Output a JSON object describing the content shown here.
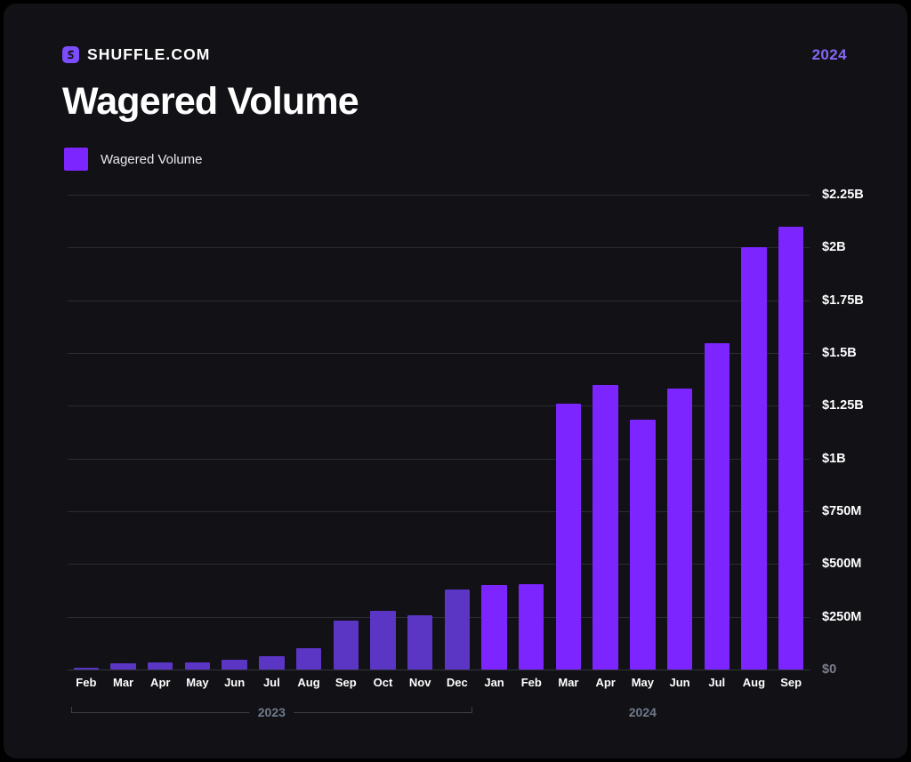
{
  "header": {
    "brand_name": "SHUFFLE.COM",
    "brand_icon": "shuffle-logo-icon",
    "year_badge": "2024",
    "title": "Wagered Volume"
  },
  "legend": {
    "swatch_color": "#7C25FF",
    "label": "Wagered Volume"
  },
  "colors": {
    "background": "#111116",
    "page_background": "#000000",
    "bar_2023": "#5B35C4",
    "bar_2024": "#7C25FF",
    "gridline": "#2B2B33",
    "text_primary": "#FFFFFF",
    "text_muted": "#707A8A",
    "accent": "#8567F2"
  },
  "chart_data": {
    "type": "bar",
    "title": "Wagered Volume",
    "xlabel": "",
    "ylabel": "",
    "ylim": [
      0,
      2250000000
    ],
    "grid": true,
    "legend_position": "top-left",
    "ytick_labels": [
      "$2.25B",
      "$2B",
      "$1.75B",
      "$1.5B",
      "$1.25B",
      "$1B",
      "$750M",
      "$500M",
      "$250M",
      "$0"
    ],
    "ytick_values": [
      2250000000,
      2000000000,
      1750000000,
      1500000000,
      1250000000,
      1000000000,
      750000000,
      500000000,
      250000000,
      0
    ],
    "categories": [
      "Feb",
      "Mar",
      "Apr",
      "May",
      "Jun",
      "Jul",
      "Aug",
      "Sep",
      "Oct",
      "Nov",
      "Dec",
      "Jan",
      "Feb",
      "Mar",
      "Apr",
      "May",
      "Jun",
      "Jul",
      "Aug",
      "Sep"
    ],
    "series": [
      {
        "name": "Wagered Volume",
        "values": [
          8000000,
          30000000,
          35000000,
          33000000,
          45000000,
          65000000,
          100000000,
          232000000,
          280000000,
          255000000,
          378000000,
          400000000,
          403000000,
          1260000000,
          1350000000,
          1185000000,
          1330000000,
          1545000000,
          2000000000,
          2100000000
        ]
      }
    ],
    "bar_colors": [
      "#5B35C4",
      "#5B35C4",
      "#5B35C4",
      "#5B35C4",
      "#5B35C4",
      "#5B35C4",
      "#5B35C4",
      "#5B35C4",
      "#5B35C4",
      "#5B35C4",
      "#5B35C4",
      "#7C25FF",
      "#7C25FF",
      "#7C25FF",
      "#7C25FF",
      "#7C25FF",
      "#7C25FF",
      "#7C25FF",
      "#7C25FF",
      "#7C25FF"
    ],
    "groups": [
      {
        "label": "2023",
        "start_index": 0,
        "end_index": 10,
        "bracket": true
      },
      {
        "label": "2024",
        "start_index": 11,
        "end_index": 19,
        "bracket": false
      }
    ]
  }
}
